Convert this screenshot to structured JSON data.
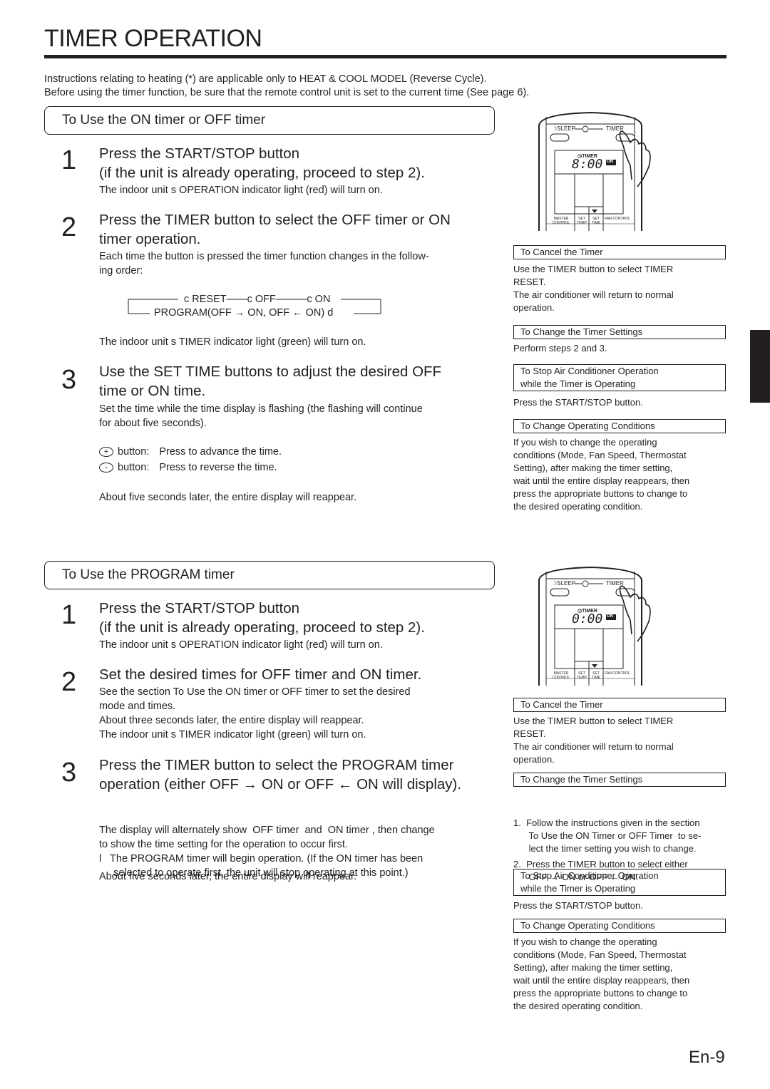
{
  "page": {
    "title": "TIMER OPERATION",
    "intro": [
      "Instructions relating to heating (*) are applicable only to  HEAT & COOL MODEL  (Reverse Cycle).",
      "Before using the timer function, be sure that the remote control unit is set to the current time (See page 6)."
    ],
    "page_number": "En-9"
  },
  "section1": {
    "heading": "To Use the ON timer or OFF timer",
    "steps": [
      {
        "number": "1",
        "head": [
          "Press the START/STOP button",
          "(if the unit is already operating, proceed to step 2)."
        ],
        "body": [
          "The indoor unit s OPERATION indicator light (red) will turn on."
        ]
      },
      {
        "number": "2",
        "head": [
          "Press the TIMER button to select the OFF timer or ON",
          "timer operation."
        ],
        "body": [
          "Each time the button is pressed the timer function changes in the follow-",
          "ing order:",
          "The indoor unit s TIMER indicator light (green) will turn on."
        ]
      },
      {
        "number": "3",
        "head": [
          "Use the SET TIME buttons to adjust the desired OFF",
          "time or ON time."
        ],
        "body": [
          "Set the time while the time display is flashing (the flashing will continue",
          "for about five seconds).",
          "About five seconds later, the entire display will reappear."
        ],
        "buttons": [
          {
            "icon": "plus-circle-icon",
            "glyph": "+",
            "label": "button:",
            "desc": "Press to advance the time."
          },
          {
            "icon": "minus-circle-icon",
            "glyph": "-",
            "label": "button:",
            "desc": "Press to reverse the time."
          }
        ]
      }
    ],
    "cycle": {
      "top_row": "c RESET——c OFF———c ON",
      "bottom_row": "PROGRAM(OFF → ON, OFF ← ON) d"
    }
  },
  "section2": {
    "heading": "To Use the PROGRAM timer",
    "steps": [
      {
        "number": "1",
        "head": [
          "Press the START/STOP button",
          "(if the unit is already operating, proceed to step 2)."
        ],
        "body": [
          "The indoor unit s OPERATION indicator light (red) will turn on."
        ]
      },
      {
        "number": "2",
        "head": [
          "Set the desired times for OFF timer and ON timer."
        ],
        "body": [
          "See the section  To Use the ON timer or OFF timer  to set the desired",
          "mode and times.",
          "About three seconds later, the entire display will reappear.",
          "The indoor unit s TIMER indicator light (green) will turn on."
        ]
      },
      {
        "number": "3",
        "head": [
          "Press the TIMER button to select the PROGRAM timer",
          "operation (either OFF   → ON or OFF ← ON will display)."
        ],
        "body": [
          "The display will alternately show  OFF timer  and  ON timer , then change",
          "to show the time setting for the operation to occur first.",
          "l   The PROGRAM timer will begin operation. (If the ON timer has been",
          "     selected to operate first, the unit will stop operating at this point.)",
          "About five seconds later, the entire display will reappear."
        ]
      }
    ]
  },
  "remote1": {
    "sleep_label": "SLEEP",
    "timer_label": "TIMER",
    "display_label": "TIMER",
    "display_time": "8:00",
    "display_badge": "ON",
    "bottom_labels": [
      "MASTER CONTROL",
      "SET TEMP",
      "SET TIME",
      "FAN CONTROL"
    ]
  },
  "remote2": {
    "sleep_label": "SLEEP",
    "timer_label": "TIMER",
    "display_label": "TIMER",
    "display_time": "0:00",
    "display_badge": "ON",
    "bottom_labels": [
      "MASTER CONTROL",
      "SET TEMP",
      "SET TIME",
      "FAN CONTROL"
    ]
  },
  "notes1": [
    {
      "title": [
        "To Cancel the Timer"
      ],
      "text": [
        "Use the TIMER button to select  TIMER",
        "RESET.",
        "The air conditioner will return to normal",
        "operation."
      ]
    },
    {
      "title": [
        "To Change the Timer Settings"
      ],
      "text": [
        "Perform steps  2 and 3."
      ]
    },
    {
      "title": [
        "To Stop Air Conditioner Operation",
        "while the Timer is Operating"
      ],
      "text": [
        "Press the START/STOP button."
      ]
    },
    {
      "title": [
        "To Change Operating Conditions"
      ],
      "text": [
        "If you wish to change the operating",
        "conditions (Mode, Fan Speed, Thermostat",
        "Setting), after making the timer setting,",
        "wait until the entire display reappears, then",
        "press the appropriate buttons to change to",
        "the desired operating condition."
      ]
    }
  ],
  "notes2": [
    {
      "title": [
        "To Cancel the Timer"
      ],
      "text": [
        "Use the TIMER button to select  TIMER",
        "RESET.",
        "The air conditioner will return to normal",
        "operation."
      ]
    },
    {
      "title": [
        "To Change the Timer Settings"
      ],
      "text": [
        "1.  Follow the instructions given in the section",
        "      To Use the ON Timer or OFF Timer  to se-",
        "      lect the timer setting you wish to change.",
        "2.  Press the TIMER button to select either",
        "      OFF → ON or OFF ← ON."
      ]
    },
    {
      "title": [
        "To Stop Air Conditioner Operation",
        "while the Timer is Operating"
      ],
      "text": [
        "Press the START/STOP button."
      ]
    },
    {
      "title": [
        "To Change Operating Conditions"
      ],
      "text": [
        "If you wish to change the operating",
        "conditions (Mode, Fan Speed, Thermostat",
        "Setting), after making the timer setting,",
        "wait until the entire display reappears, then",
        "press the appropriate buttons to change to",
        "the desired operating condition."
      ]
    }
  ]
}
